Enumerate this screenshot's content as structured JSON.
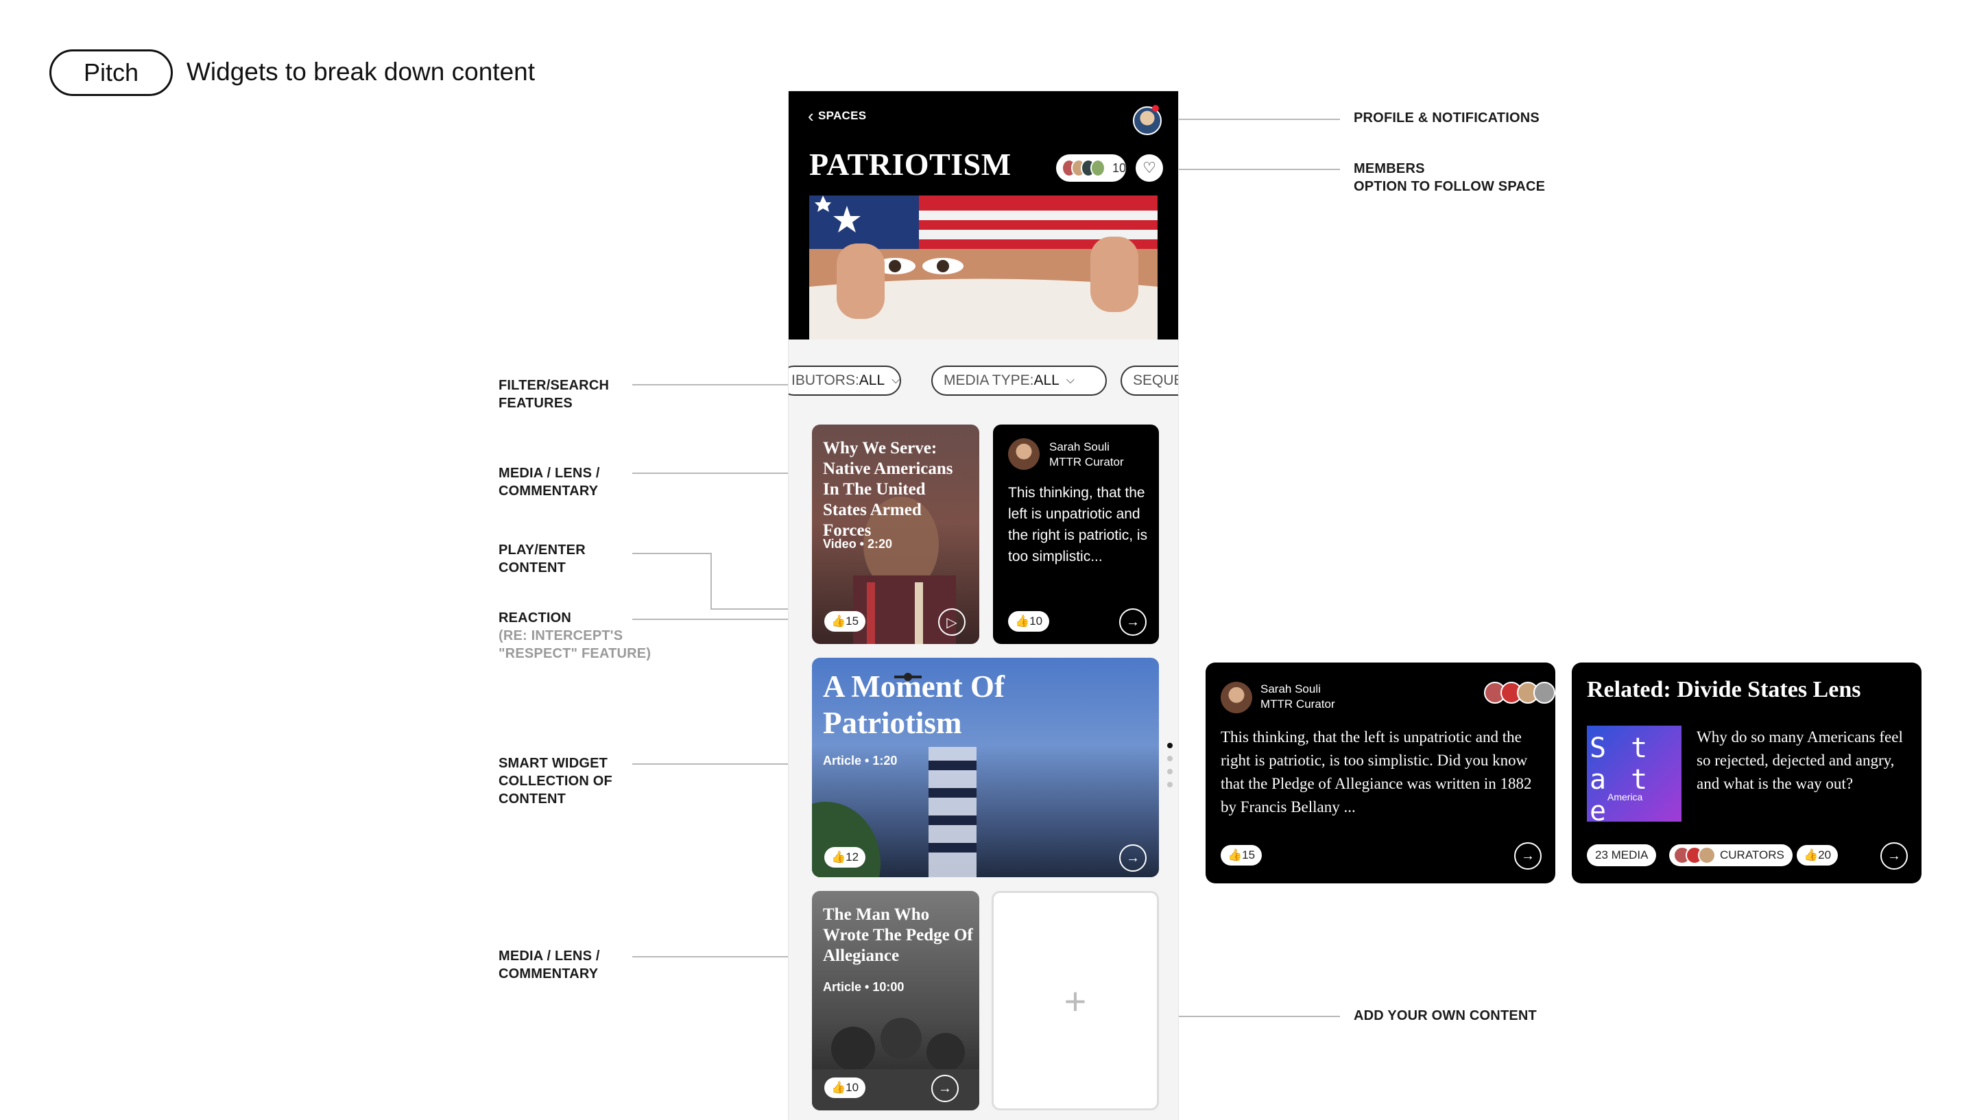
{
  "header": {
    "pill": "Pitch",
    "subtitle": "Widgets to break down content"
  },
  "annotations": {
    "profile": "PROFILE & NOTIFICATIONS",
    "members_l1": "MEMBERS",
    "members_l2": "OPTION TO FOLLOW SPACE",
    "filter_l1": "FILTER/SEARCH",
    "filter_l2": "FEATURES",
    "media1_l1": "MEDIA / LENS /",
    "media1_l2": "COMMENTARY",
    "play_l1": "PLAY/ENTER",
    "play_l2": "CONTENT",
    "reaction_l1": "REACTION",
    "reaction_l2": "(RE: INTERCEPT'S",
    "reaction_l3": "\"RESPECT\" FEATURE)",
    "smart_l1": "SMART WIDGET",
    "smart_l2": "COLLECTION OF",
    "smart_l3": "CONTENT",
    "media2_l1": "MEDIA / LENS /",
    "media2_l2": "COMMENTARY",
    "add": "ADD YOUR OWN CONTENT"
  },
  "phone": {
    "back_label": "SPACES",
    "title": "PATRIOTISM",
    "member_count": "10",
    "filters": [
      {
        "label": "IBUTORS: ",
        "value": "ALL"
      },
      {
        "label": "MEDIA TYPE: ",
        "value": "ALL"
      },
      {
        "label": "SEQUE",
        "value": ""
      }
    ],
    "card1": {
      "title": "Why We Serve: Native Americans In The United States Armed Forces",
      "meta": "Video • 2:20",
      "reactions": "15"
    },
    "card2": {
      "name": "Sarah Souli",
      "role": "MTTR Curator",
      "text": "This thinking, that the left is unpatriotic and the right is patriotic, is too simplistic...",
      "reactions": "10"
    },
    "card3": {
      "title": "A Moment Of Patriotism",
      "meta": "Article • 1:20",
      "reactions": "12"
    },
    "card4": {
      "title": "The Man Who Wrote The Pedge Of Allegiance",
      "meta": "Article • 10:00",
      "reactions": "10"
    },
    "add_symbol": "+"
  },
  "right_cards": {
    "quote": {
      "name": "Sarah Souli",
      "role": "MTTR Curator",
      "text": "This thinking, that the left is unpatriotic and the right is patriotic, is too simplistic. Did you know that the Pledge of Allegiance was written in 1882 by Francis Bellany ...",
      "reactions": "15"
    },
    "lens": {
      "title": "Related: Divide States Lens",
      "text": "Why do so many Americans feel so rejected, dejected and angry, and what is the way out?",
      "media": "23 MEDIA",
      "curators": "CURATORS",
      "reactions": "20",
      "thumb_text": "S t a t e",
      "thumb_small": "America"
    }
  },
  "icons": {
    "thumb": "thumbs-up-icon",
    "play": "play-icon",
    "arrow": "arrow-right-icon",
    "heart": "heart-icon",
    "chevron": "chevron-down-icon"
  },
  "colors": {
    "accent_dark": "#000000",
    "background": "#ffffff",
    "annotation_line": "#b8b8b8"
  }
}
